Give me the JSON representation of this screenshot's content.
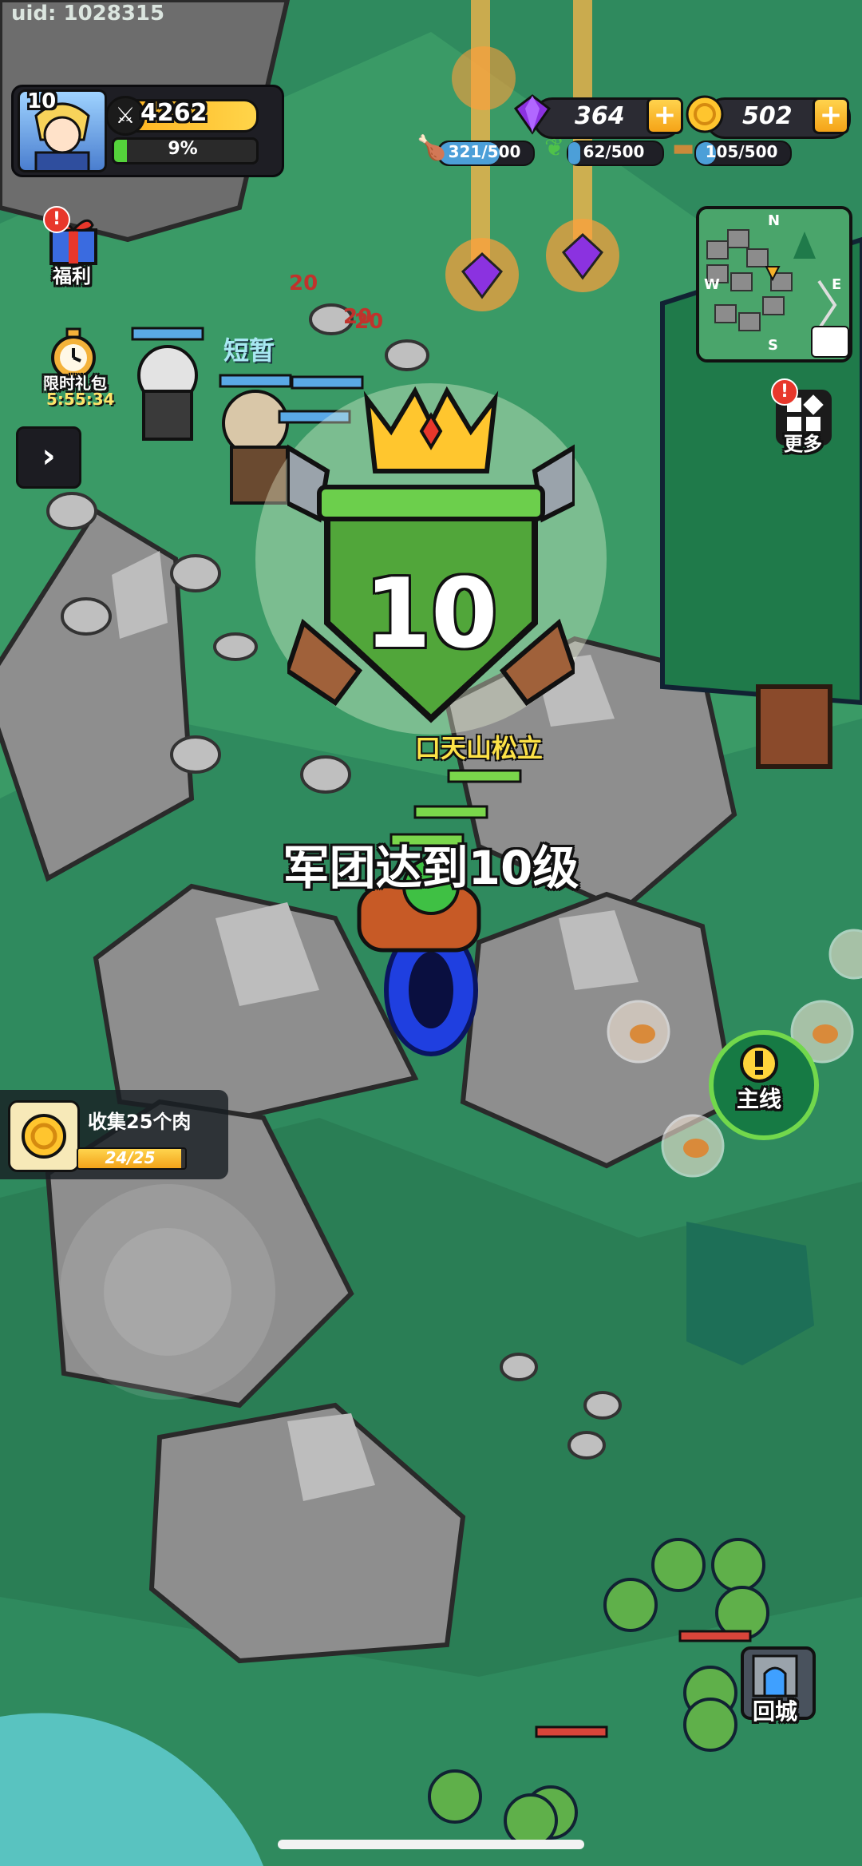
{
  "uid": "uid: 1028315",
  "player": {
    "level": "10",
    "power": "4262",
    "exp_percent": "9%",
    "exp_fraction": 0.09
  },
  "resources": {
    "gems": "364",
    "gold": "502",
    "meat": "321/500",
    "herb": "62/500",
    "wood": "105/500",
    "meat_fraction": 0.642,
    "herb_fraction": 0.124,
    "wood_fraction": 0.21
  },
  "left_menu": {
    "welfare": "福利",
    "limited_gift": "限时礼包",
    "limited_timer": "5:55:34"
  },
  "minimap": {
    "n": "N",
    "s": "S",
    "w": "W",
    "e": "E"
  },
  "more": "更多",
  "npc_name": "短暂",
  "damage": [
    "20",
    "20",
    "20"
  ],
  "level_up": {
    "level": "10",
    "announcement": "军团达到10级"
  },
  "player_name": "口天山松立",
  "quest": {
    "text": "收集25个肉",
    "progress": "24/25",
    "progress_fraction": 0.96
  },
  "main_quest": "主线",
  "return_city": "回城",
  "colors": {
    "grass": "#2f8a5e",
    "gold": "#ffb11c",
    "rock": "#8a8a8a",
    "accent_green": "#72d84c"
  }
}
